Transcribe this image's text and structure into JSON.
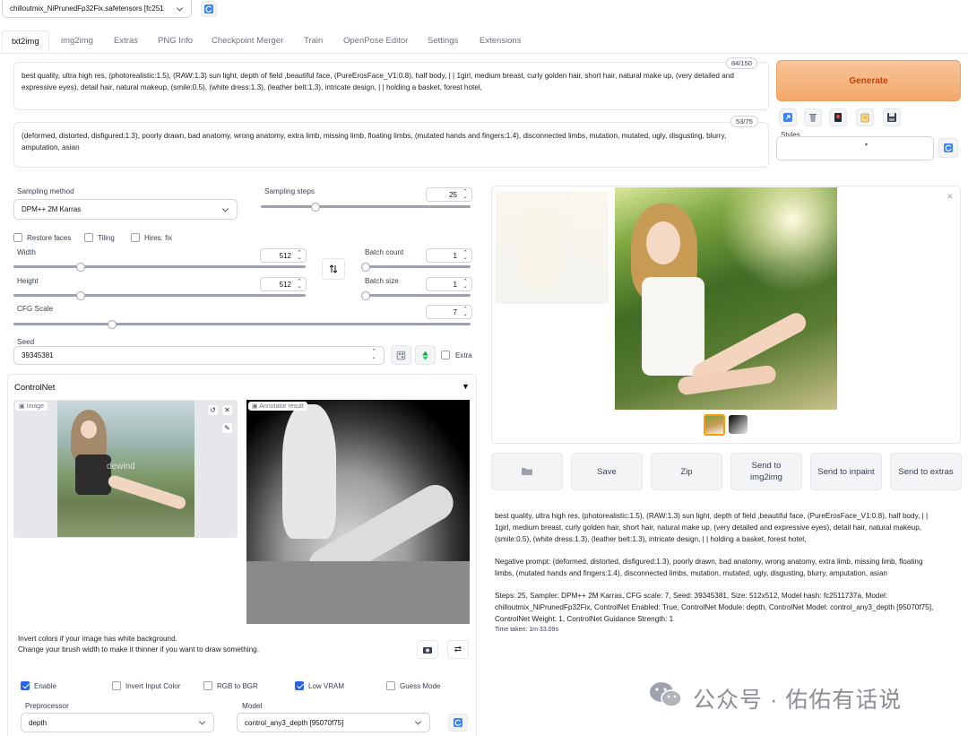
{
  "model_select": {
    "value": "chilloutmix_NiPrunedFp32Fix.safetensors [fc251"
  },
  "tabs": [
    "txt2img",
    "img2img",
    "Extras",
    "PNG Info",
    "Checkpoint Merger",
    "Train",
    "OpenPose Editor",
    "Settings",
    "Extensions"
  ],
  "prompt": {
    "positive": "best quality, ultra high res, (photorealistic:1.5), (RAW:1.3) sun light, depth of field ,beautiful face, (PureErosFace_V1:0.8), half body, | | 1girl, medium breast, curly golden hair, short hair, natural make up, (very detailed and expressive eyes), detail hair, natural makeup, (smile:0.5), (white dress:1.3), (leather belt:1.3), intricate design, | | holding a basket, forest hotel,",
    "positive_counter": "84/150",
    "negative": "(deformed, distorted, disfigured:1.3), poorly drawn, bad anatomy, wrong anatomy, extra limb, missing limb, floating limbs, (mutated hands and fingers:1.4), disconnected limbs, mutation, mutated, ugly, disgusting, blurry, amputation, asian",
    "negative_counter": "53/75"
  },
  "generate_label": "Generate",
  "styles_label": "Styles",
  "sampling": {
    "method_label": "Sampling method",
    "method_value": "DPM++ 2M Karras",
    "steps_label": "Sampling steps",
    "steps_value": "25",
    "steps_fraction": 0.25
  },
  "options": {
    "restore_faces": "Restore faces",
    "tiling": "Tiling",
    "hires_fix": "Hires. fix"
  },
  "width": {
    "label": "Width",
    "value": "512",
    "fraction": 0.22
  },
  "height": {
    "label": "Height",
    "value": "512",
    "fraction": 0.22
  },
  "batch_count": {
    "label": "Batch count",
    "value": "1",
    "fraction": 0
  },
  "batch_size": {
    "label": "Batch size",
    "value": "1",
    "fraction": 0
  },
  "cfg": {
    "label": "CFG Scale",
    "value": "7",
    "fraction": 0.21
  },
  "seed": {
    "label": "Seed",
    "value": "39345381",
    "extra_label": "Extra"
  },
  "controlnet": {
    "title": "ControlNet",
    "image_label": "Image",
    "annotator_label": "Annotator result",
    "hint_line1": "Invert colors if your image has white background.",
    "hint_line2": "Change your brush width to make it thinner if you want to draw something.",
    "enable": "Enable",
    "invert": "Invert Input Color",
    "rgb": "RGB to BGR",
    "low_vram": "Low VRAM",
    "guess": "Guess Mode",
    "preprocessor_label": "Preprocessor",
    "preprocessor_value": "depth",
    "model_label": "Model",
    "model_value": "control_any3_depth [95070f75]"
  },
  "actions": {
    "save": "Save",
    "zip": "Zip",
    "send_img2img": "Send to img2img",
    "send_inpaint": "Send to inpaint",
    "send_extras": "Send to extras"
  },
  "output_info": {
    "prompt": "best quality, ultra high res, (photorealistic:1.5), (RAW:1.3) sun light, depth of field ,beautiful face, (PureErosFace_V1:0.8), half body, | | 1girl, medium breast, curly golden hair, short hair, natural make up, (very detailed and expressive eyes), detail hair, natural makeup, (smile:0.5), (white dress:1.3), (leather belt:1.3), intricate design, | | holding a basket, forest hotel,",
    "negative": "Negative prompt: (deformed, distorted, disfigured:1.3), poorly drawn, bad anatomy, wrong anatomy, extra limb, missing limb, floating limbs, (mutated hands and fingers:1.4), disconnected limbs, mutation, mutated, ugly, disgusting, blurry, amputation, asian",
    "params": "Steps: 25, Sampler: DPM++ 2M Karras, CFG scale: 7, Seed: 39345381, Size: 512x512, Model hash: fc2511737a, Model: chilloutmix_NiPrunedFp32Fix, ControlNet Enabled: True, ControlNet Module: depth, ControlNet Model: control_any3_depth [95070f75], ControlNet Weight: 1, ControlNet Guidance Strength: 1",
    "time": "Time taken: 1m 33.09s"
  },
  "watermark": "公众号 · 佑佑有话说",
  "image_watermark": "dewind",
  "colors": {
    "generate": "#f5b37a",
    "accent": "#2563eb"
  }
}
